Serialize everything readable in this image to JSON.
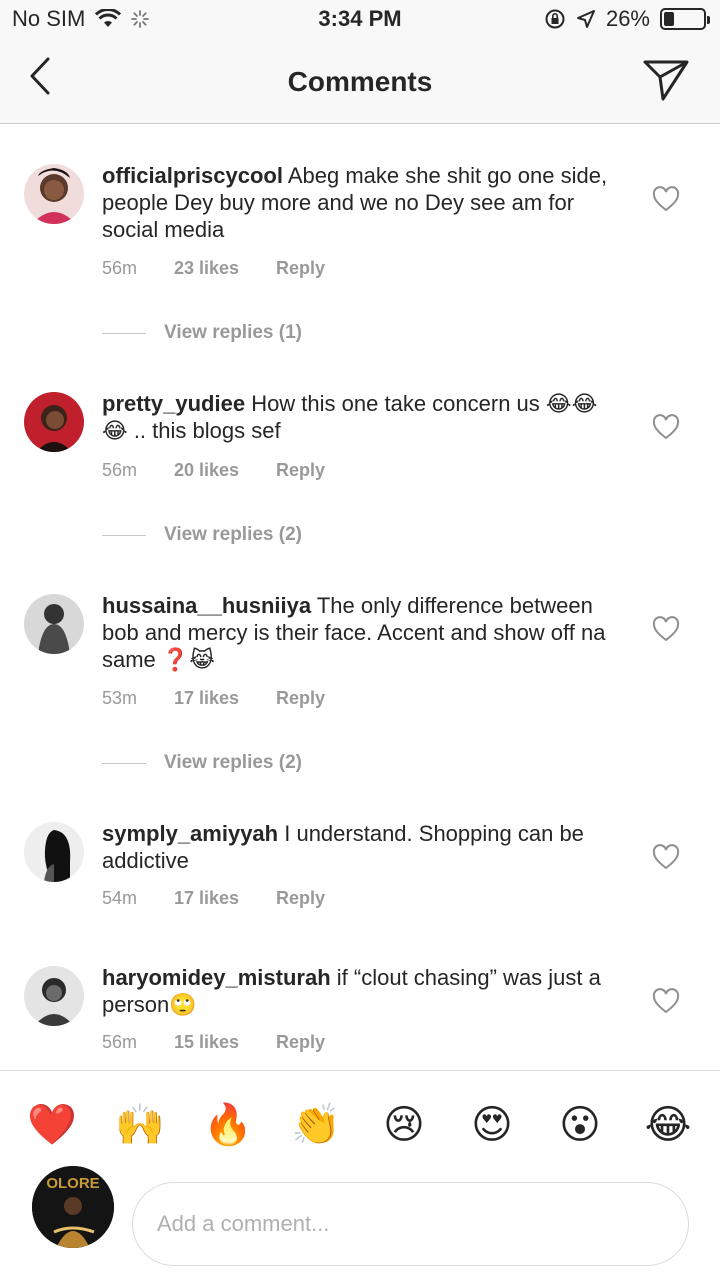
{
  "status_bar": {
    "carrier": "No SIM",
    "time": "3:34 PM",
    "battery": "26%",
    "battery_level": 0.26
  },
  "nav": {
    "title": "Comments"
  },
  "comments": [
    {
      "username": "officialpriscycool",
      "text": "Abeg make she shit go one side, people Dey buy more and we no Dey see am for social media",
      "time": "56m",
      "likes": "23 likes",
      "reply": "Reply",
      "view_replies": "View replies (1)"
    },
    {
      "username": "pretty_yudiee",
      "text": "How this one take concern us 😂😂😂 .. this blogs sef",
      "time": "56m",
      "likes": "20 likes",
      "reply": "Reply",
      "view_replies": "View replies (2)"
    },
    {
      "username": "hussaina__husniiya",
      "text": "The only difference between bob and mercy is their face. Accent and show off na same ❓😹",
      "time": "53m",
      "likes": "17 likes",
      "reply": "Reply",
      "view_replies": "View replies (2)"
    },
    {
      "username": "symply_amiyyah",
      "text": "I understand. Shopping can be addictive",
      "time": "54m",
      "likes": "17 likes",
      "reply": "Reply"
    },
    {
      "username": "haryomidey_misturah",
      "text": "if “clout chasing” was just a person🙄",
      "time": "56m",
      "likes": "15 likes",
      "reply": "Reply"
    }
  ],
  "emoji_bar": [
    "❤️",
    "🙌",
    "🔥",
    "👏",
    "😢",
    "😍",
    "😮",
    "😂"
  ],
  "composer": {
    "placeholder": "Add a comment...",
    "avatar_text": "OLORE"
  }
}
